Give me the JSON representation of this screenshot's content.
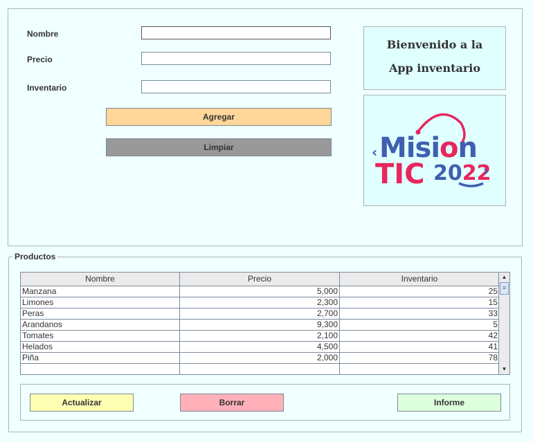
{
  "form": {
    "nombre_label": "Nombre",
    "nombre_value": "",
    "precio_label": "Precio",
    "precio_value": "",
    "inventario_label": "Inventario",
    "inventario_value": "",
    "agregar": "Agregar",
    "limpiar": "Limpiar"
  },
  "welcome": {
    "line1": "Bienvenido a la",
    "line2": "App inventario"
  },
  "logo": {
    "text1": "Mision",
    "text2": "TIC",
    "text3": "2022"
  },
  "productos": {
    "title": "Productos",
    "columns": [
      "Nombre",
      "Precio",
      "Inventario"
    ],
    "rows": [
      [
        "Manzana",
        "5,000",
        "25"
      ],
      [
        "Limones",
        "2,300",
        "15"
      ],
      [
        "Peras",
        "2,700",
        "33"
      ],
      [
        "Arandanos",
        "9,300",
        "5"
      ],
      [
        "Tomates",
        "2,100",
        "42"
      ],
      [
        "Helados",
        "4,500",
        "41"
      ],
      [
        "Piña",
        "2,000",
        "78"
      ],
      [
        "",
        "",
        ""
      ]
    ]
  },
  "buttons": {
    "actualizar": "Actualizar",
    "borrar": "Borrar",
    "informe": "Informe"
  },
  "colors": {
    "agregar": "#ffd699",
    "limpiar": "#999999",
    "actualizar": "#ffffb3",
    "borrar": "#ffb0b8",
    "informe": "#dcffdc"
  }
}
